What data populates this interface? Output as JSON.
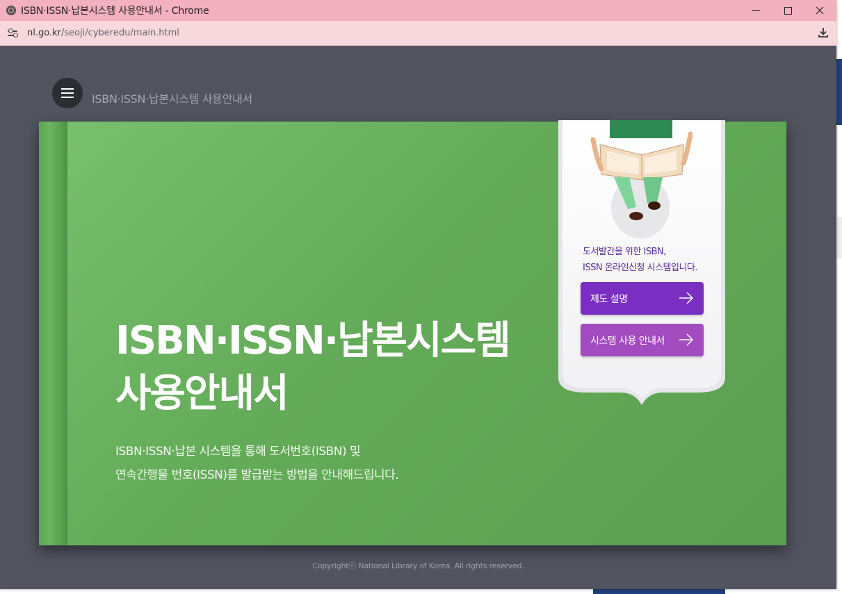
{
  "window": {
    "title": "ISBN·ISSN·납본시스템 사용안내서 - Chrome"
  },
  "address_bar": {
    "domain": "nl.go.kr",
    "path": "/seoji/cyberedu/main.html"
  },
  "header": {
    "page_title": "ISBN·ISSN·납본시스템 사용안내서"
  },
  "hero": {
    "title_line1": "ISBN·ISSN·납본시스템",
    "title_line2": "사용안내서",
    "desc_line1": "ISBN·ISSN·납본 시스템을 통해 도서번호(ISBN) 및",
    "desc_line2": "연속간행물 번호(ISSN)를 발급받는 방법을 안내해드립니다."
  },
  "bookmark": {
    "text_line1": "도서발간을 위한 ISBN,",
    "text_line2": "ISSN 온라인신청 시스템입니다.",
    "button1_label": "제도 설명",
    "button2_label": "시스템 사용 안내서"
  },
  "footer": {
    "copyright": "Copyrightⓒ National Library of Korea. All rights reserved."
  },
  "colors": {
    "book_green": "#64ab59",
    "button_primary": "#7a2fc2",
    "button_secondary": "#a24cc0",
    "bookmark_text": "#5a2a9a"
  }
}
